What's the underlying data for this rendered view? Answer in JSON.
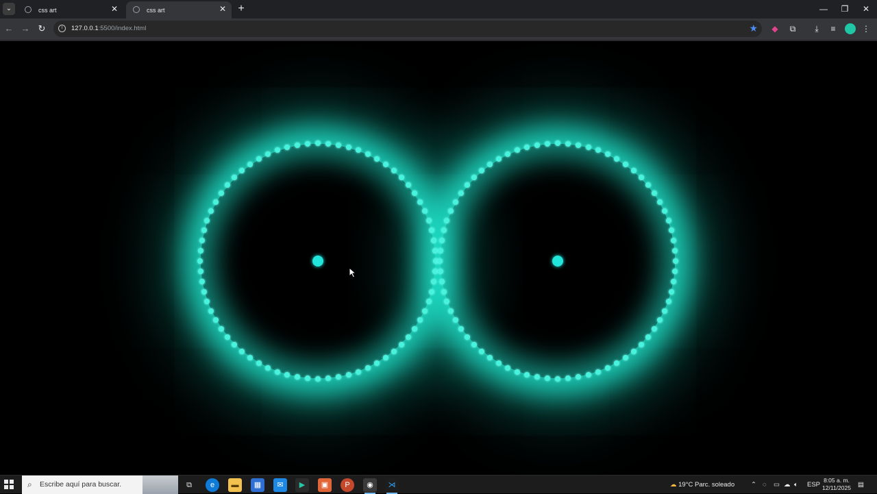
{
  "browser": {
    "tabs": [
      {
        "title": "css art",
        "active": false
      },
      {
        "title": "css art",
        "active": true
      }
    ],
    "url_host": "127.0.0.1",
    "url_rest": ":5500/index.html"
  },
  "art": {
    "glow_color": "#1fe0c8",
    "dot_color": "#48f3de",
    "center_dot_color": "#22e6dc"
  },
  "taskbar": {
    "search_placeholder": "Escribe aquí para buscar.",
    "weather": "19°C  Parc. soleado",
    "language": "ESP",
    "time": "8:05 a. m.",
    "date": "12/11/2025"
  }
}
